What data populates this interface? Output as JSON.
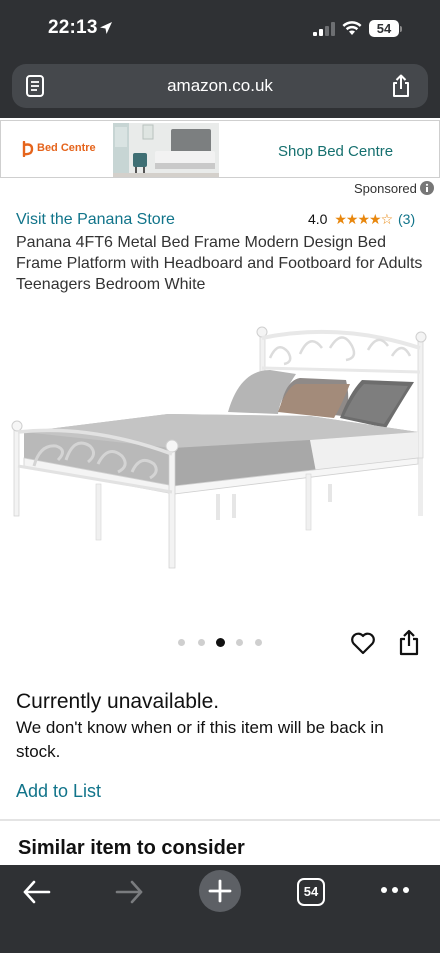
{
  "status_bar": {
    "time": "22:13",
    "battery": "54"
  },
  "browser": {
    "url": "amazon.co.uk",
    "tab_count": "54"
  },
  "ad": {
    "logo_text": "Bed Centre",
    "cta": "Shop Bed Centre",
    "sponsored_label": "Sponsored"
  },
  "product": {
    "store_link": "Visit the Panana Store",
    "rating_value": "4.0",
    "stars": "★★★★☆",
    "rating_count": "(3)",
    "title": "Panana 4FT6 Metal Bed Frame Modern Design Bed Frame Platform with Headboard and Footboard for Adults Teenagers Bedroom White",
    "image_count": 5,
    "active_image_index": 2
  },
  "availability": {
    "status": "Currently unavailable.",
    "message": "We don't know when or if this item will be back in stock.",
    "add_to_list": "Add to List"
  },
  "similar": {
    "heading": "Similar item to consider"
  },
  "colors": {
    "chrome": "#2f3134",
    "link": "#11748a",
    "star": "#e8870e",
    "ad_cta": "#16706f"
  }
}
